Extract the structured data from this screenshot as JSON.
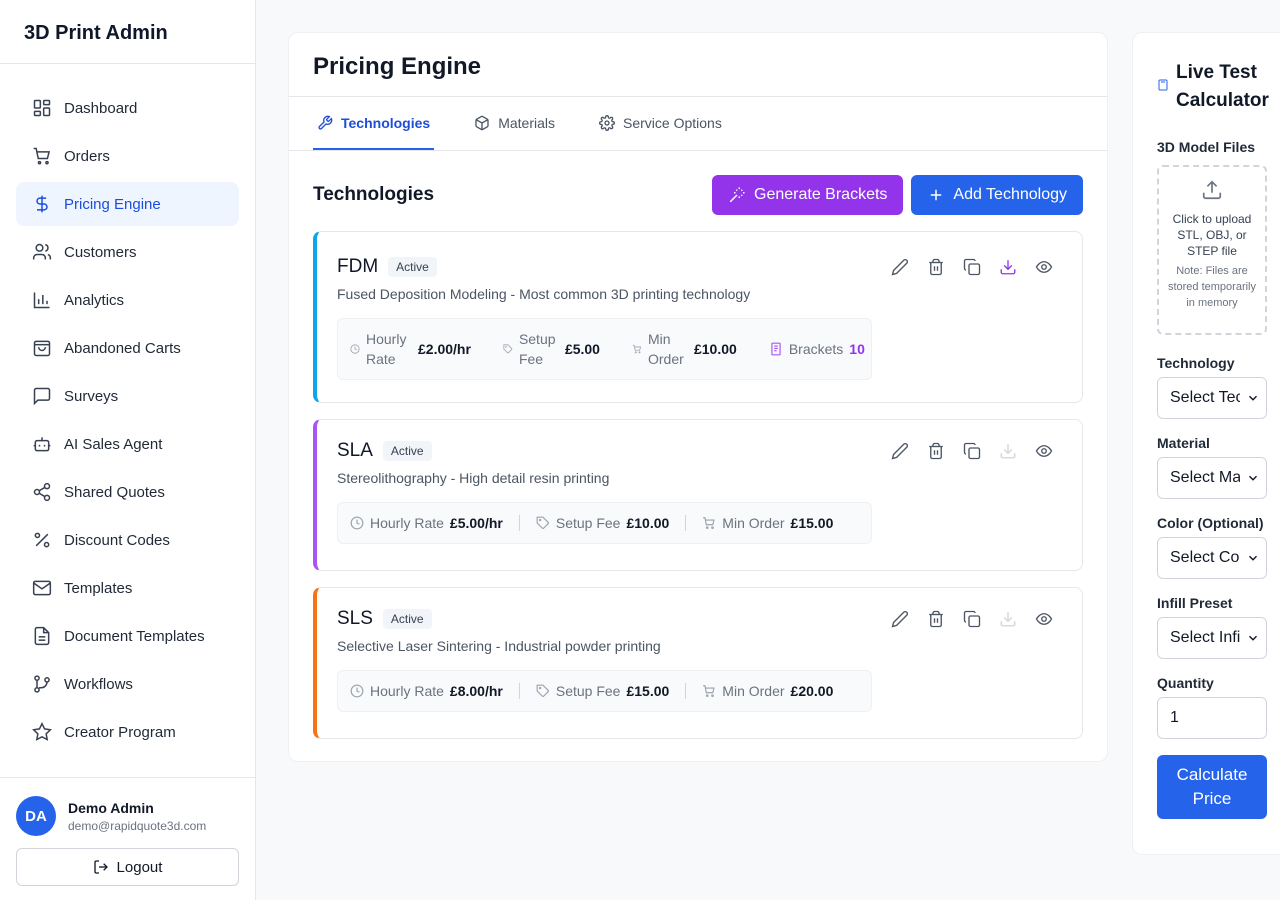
{
  "app": {
    "title": "3D Print Admin"
  },
  "sidebar": {
    "items": [
      {
        "label": "Dashboard",
        "icon": "grid-icon"
      },
      {
        "label": "Orders",
        "icon": "cart-icon"
      },
      {
        "label": "Pricing Engine",
        "icon": "dollar-icon"
      },
      {
        "label": "Customers",
        "icon": "users-icon"
      },
      {
        "label": "Analytics",
        "icon": "bar-chart-icon"
      },
      {
        "label": "Abandoned Carts",
        "icon": "bag-icon"
      },
      {
        "label": "Surveys",
        "icon": "message-icon"
      },
      {
        "label": "AI Sales Agent",
        "icon": "bot-icon"
      },
      {
        "label": "Shared Quotes",
        "icon": "share-icon"
      },
      {
        "label": "Discount Codes",
        "icon": "percent-icon"
      },
      {
        "label": "Templates",
        "icon": "mail-icon"
      },
      {
        "label": "Document Templates",
        "icon": "document-icon"
      },
      {
        "label": "Workflows",
        "icon": "branch-icon"
      },
      {
        "label": "Creator Program",
        "icon": "star-icon"
      }
    ],
    "active": "Pricing Engine"
  },
  "user": {
    "initials": "DA",
    "name": "Demo Admin",
    "email": "demo@rapidquote3d.com",
    "logout_label": "Logout"
  },
  "main": {
    "title": "Pricing Engine",
    "tabs": [
      {
        "label": "Technologies",
        "icon": "wrench-icon",
        "active": true
      },
      {
        "label": "Materials",
        "icon": "box-icon",
        "active": false
      },
      {
        "label": "Service Options",
        "icon": "gear-icon",
        "active": false
      }
    ],
    "section_title": "Technologies",
    "generate_label": "Generate Brackets",
    "add_label": "Add Technology",
    "technologies": [
      {
        "name": "FDM",
        "status": "Active",
        "description": "Fused Deposition Modeling - Most common 3D printing technology",
        "accent": "#0ea5e9",
        "hourly_label": "Hourly Rate",
        "hourly": "£2.00/hr",
        "setup_label": "Setup Fee",
        "setup": "£5.00",
        "min_label": "Min Order",
        "min": "£10.00",
        "brackets_label": "Brackets",
        "brackets": "10"
      },
      {
        "name": "SLA",
        "status": "Active",
        "description": "Stereolithography - High detail resin printing",
        "accent": "#a855f7",
        "hourly_label": "Hourly Rate",
        "hourly": "£5.00/hr",
        "setup_label": "Setup Fee",
        "setup": "£10.00",
        "min_label": "Min Order",
        "min": "£15.00"
      },
      {
        "name": "SLS",
        "status": "Active",
        "description": "Selective Laser Sintering - Industrial powder printing",
        "accent": "#f97316",
        "hourly_label": "Hourly Rate",
        "hourly": "£8.00/hr",
        "setup_label": "Setup Fee",
        "setup": "£15.00",
        "min_label": "Min Order",
        "min": "£20.00"
      }
    ]
  },
  "calculator": {
    "title": "Live Test Calculator",
    "files_label": "3D Model Files",
    "upload_text": "Click to upload STL, OBJ, or STEP file",
    "upload_note": "Note: Files are stored temporarily in memory",
    "technology_label": "Technology",
    "technology_value": "Select Technology",
    "material_label": "Material",
    "material_value": "Select Material",
    "color_label": "Color (Optional)",
    "color_value": "Select Color",
    "infill_label": "Infill Preset",
    "infill_value": "Select Infill",
    "quantity_label": "Quantity",
    "quantity_value": "1",
    "calculate_label": "Calculate Price"
  },
  "colors": {
    "primary": "#2563eb",
    "purple": "#9333ea"
  }
}
